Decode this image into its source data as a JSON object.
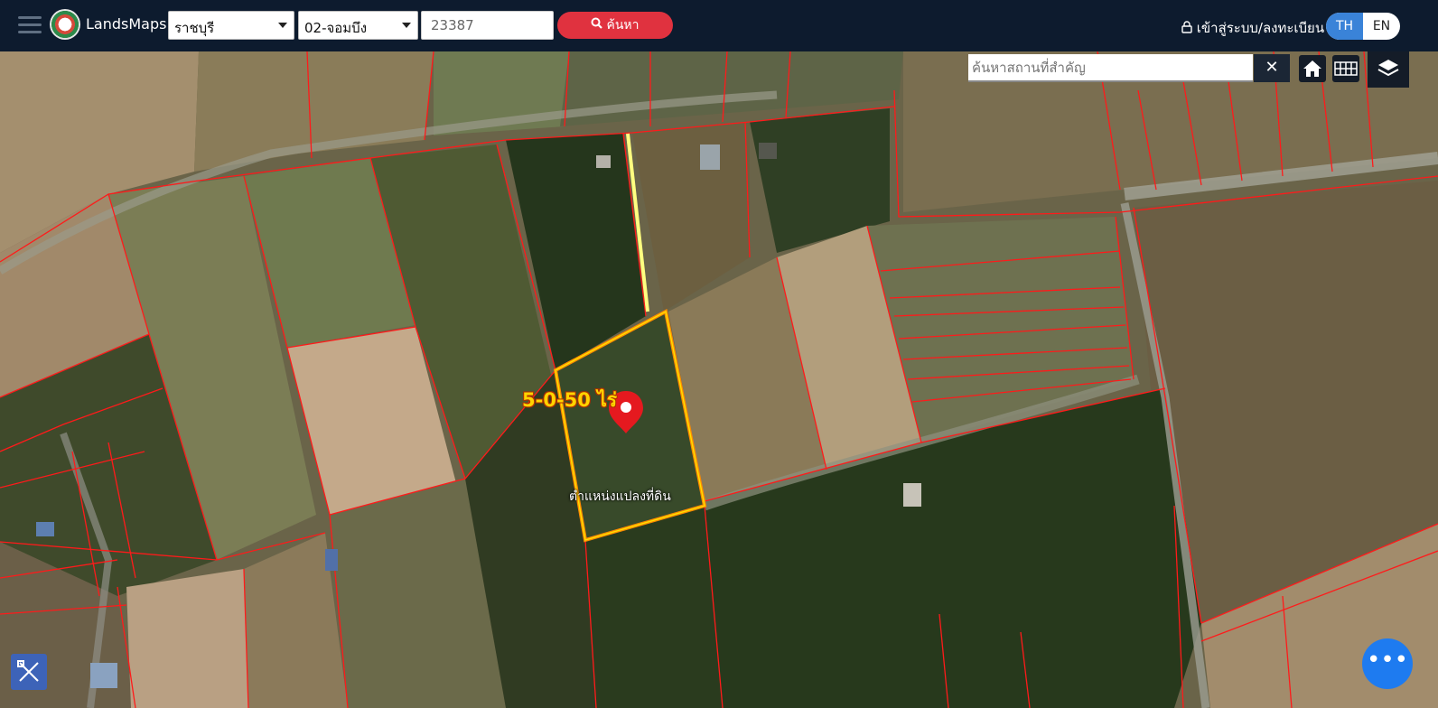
{
  "header": {
    "brand": "LandsMaps",
    "province": "ราชบุรี",
    "district": "02-จอมบึง",
    "parcel_number": "23387",
    "search_label": "ค้นหา",
    "login_label": "เข้าสู่ระบบ/ลงทะเบียน",
    "lang_th": "TH",
    "lang_en": "EN",
    "active_lang": "TH"
  },
  "map": {
    "place_search_placeholder": "ค้นหาสถานที่สำคัญ",
    "area_label": "5-0-50 ไร่",
    "pin_label": "ตำแหน่งแปลงที่ดิน"
  },
  "colors": {
    "header_bg": "#0d1b2e",
    "search_button": "#e0323f",
    "lang_active": "#3a83d8",
    "parcel_line": "#ff1a1a",
    "selected_parcel": "#ff8c00",
    "chat_button": "#1e7bf0"
  },
  "icons": [
    "menu-icon",
    "search-icon",
    "lock-icon",
    "close-icon",
    "home-icon",
    "grid-icon",
    "layers-icon",
    "map-pin-icon",
    "measure-icon",
    "more-icon"
  ]
}
